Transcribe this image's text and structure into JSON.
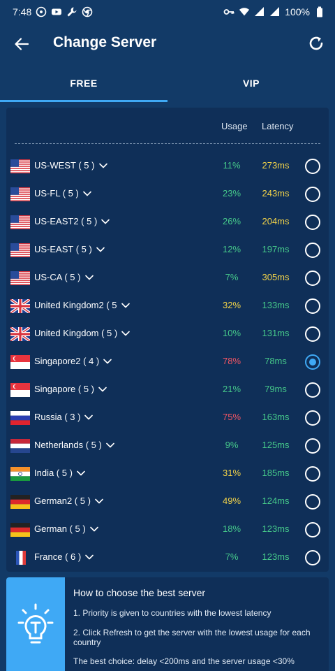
{
  "status_bar": {
    "time": "7:48",
    "battery": "100%"
  },
  "header": {
    "title": "Change Server"
  },
  "tabs": [
    {
      "label": "FREE",
      "active": true
    },
    {
      "label": "VIP",
      "active": false
    }
  ],
  "columns": {
    "usage": "Usage",
    "latency": "Latency"
  },
  "colors": {
    "green": "#46c98a",
    "yellow": "#f2d349",
    "red": "#f25563",
    "accent": "#3fa9f5"
  },
  "servers": [
    {
      "flag": "us",
      "name": "US-WEST ( 5 )",
      "usage": "11%",
      "usage_level": "green",
      "latency": "273ms",
      "latency_level": "yellow",
      "selected": false
    },
    {
      "flag": "us",
      "name": "US-FL ( 5 )",
      "usage": "23%",
      "usage_level": "green",
      "latency": "243ms",
      "latency_level": "yellow",
      "selected": false
    },
    {
      "flag": "us",
      "name": "US-EAST2 ( 5 )",
      "usage": "26%",
      "usage_level": "green",
      "latency": "204ms",
      "latency_level": "yellow",
      "selected": false
    },
    {
      "flag": "us",
      "name": "US-EAST ( 5 )",
      "usage": "12%",
      "usage_level": "green",
      "latency": "197ms",
      "latency_level": "green",
      "selected": false
    },
    {
      "flag": "us",
      "name": "US-CA ( 5 )",
      "usage": "7%",
      "usage_level": "green",
      "latency": "305ms",
      "latency_level": "yellow",
      "selected": false
    },
    {
      "flag": "uk",
      "name": "United Kingdom2 ( 5",
      "usage": "32%",
      "usage_level": "yellow",
      "latency": "133ms",
      "latency_level": "green",
      "selected": false
    },
    {
      "flag": "uk",
      "name": "United Kingdom ( 5 )",
      "usage": "10%",
      "usage_level": "green",
      "latency": "131ms",
      "latency_level": "green",
      "selected": false
    },
    {
      "flag": "sg",
      "name": "Singapore2 ( 4 )",
      "usage": "78%",
      "usage_level": "red",
      "latency": "78ms",
      "latency_level": "green",
      "selected": true
    },
    {
      "flag": "sg",
      "name": "Singapore ( 5 )",
      "usage": "21%",
      "usage_level": "green",
      "latency": "79ms",
      "latency_level": "green",
      "selected": false
    },
    {
      "flag": "ru",
      "name": "Russia ( 3 )",
      "usage": "75%",
      "usage_level": "red",
      "latency": "163ms",
      "latency_level": "green",
      "selected": false
    },
    {
      "flag": "nl",
      "name": "Netherlands ( 5 )",
      "usage": "9%",
      "usage_level": "green",
      "latency": "125ms",
      "latency_level": "green",
      "selected": false
    },
    {
      "flag": "in",
      "name": "India ( 5 )",
      "usage": "31%",
      "usage_level": "yellow",
      "latency": "185ms",
      "latency_level": "green",
      "selected": false
    },
    {
      "flag": "de",
      "name": "German2 ( 5 )",
      "usage": "49%",
      "usage_level": "yellow",
      "latency": "124ms",
      "latency_level": "green",
      "selected": false
    },
    {
      "flag": "de",
      "name": "German ( 5 )",
      "usage": "18%",
      "usage_level": "green",
      "latency": "123ms",
      "latency_level": "green",
      "selected": false
    },
    {
      "flag": "fr",
      "name": "France ( 6 )",
      "usage": "7%",
      "usage_level": "green",
      "latency": "123ms",
      "latency_level": "green",
      "selected": false
    }
  ],
  "tips": {
    "title": "How to choose the best server",
    "lines": [
      "1. Priority is given to countries with the lowest latency",
      "2. Click Refresh to get the server with the lowest usage for each country",
      "The best choice: delay <200ms and the server usage <30%"
    ]
  }
}
